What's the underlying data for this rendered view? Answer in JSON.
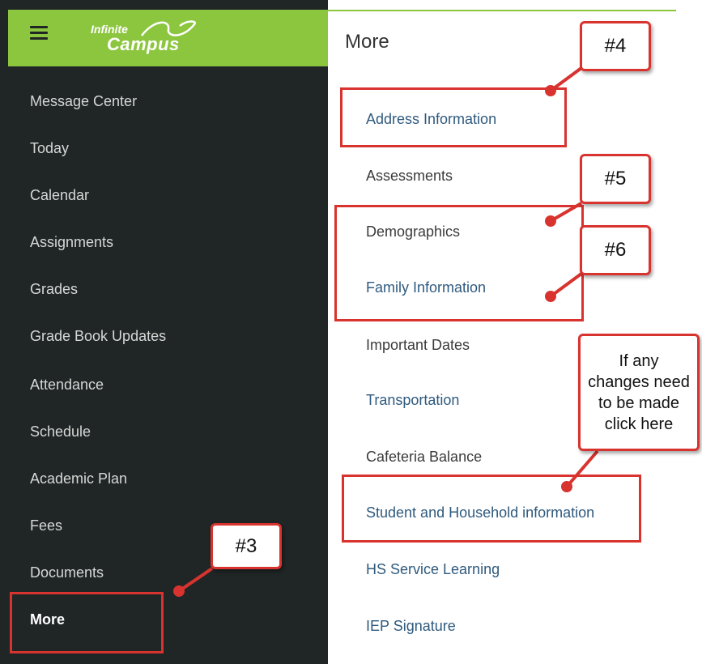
{
  "app": {
    "logo_line1": "Infinite",
    "logo_line2": "Campus"
  },
  "sidebar": {
    "items": [
      {
        "label": "Message Center"
      },
      {
        "label": "Today"
      },
      {
        "label": "Calendar"
      },
      {
        "label": "Assignments"
      },
      {
        "label": "Grades"
      },
      {
        "label": "Grade Book Updates"
      },
      {
        "label": "Attendance"
      },
      {
        "label": "Schedule"
      },
      {
        "label": "Academic Plan"
      },
      {
        "label": "Fees"
      },
      {
        "label": "Documents"
      },
      {
        "label": "More"
      }
    ],
    "active": "More"
  },
  "main": {
    "title": "More",
    "links": [
      {
        "label": "Address Information"
      },
      {
        "label": "Assessments"
      },
      {
        "label": "Demographics"
      },
      {
        "label": "Family Information"
      },
      {
        "label": "Important Dates"
      },
      {
        "label": "Transportation"
      },
      {
        "label": "Cafeteria Balance"
      },
      {
        "label": "Student and Household information"
      },
      {
        "label": "HS Service Learning"
      },
      {
        "label": "IEP Signature"
      }
    ]
  },
  "annotations": {
    "callout3": "#3",
    "callout4": "#4",
    "callout5": "#5",
    "callout6": "#6",
    "note": "If any\nchanges need\nto be made\nclick here"
  },
  "colors": {
    "sidebar_bg": "#1f2625",
    "topbar_green": "#8cc63f",
    "annotation_red": "#d8332e",
    "link_blue": "#2f5a7e"
  }
}
